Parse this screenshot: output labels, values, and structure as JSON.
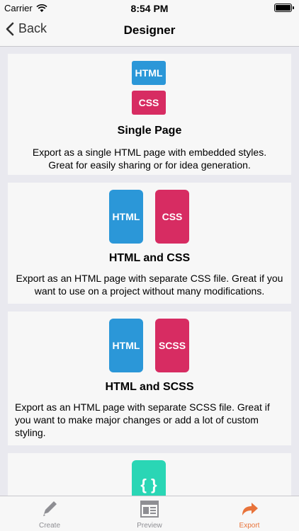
{
  "status_bar": {
    "carrier": "Carrier",
    "time": "8:54 PM"
  },
  "nav": {
    "back_label": "Back",
    "title": "Designer"
  },
  "options": [
    {
      "title": "Single Page",
      "tile1": "HTML",
      "tile2": "CSS",
      "description": "Export as a single HTML page with embedded styles. Great for easily sharing or for idea generation."
    },
    {
      "title": "HTML and CSS",
      "tile1": "HTML",
      "tile2": "CSS",
      "description": "Export as an HTML page with separate CSS file. Great if you want to use on a project without many modifications."
    },
    {
      "title": "HTML and SCSS",
      "tile1": "HTML",
      "tile2": "SCSS",
      "description": "Export as an HTML page with separate SCSS file. Great if you want to make major changes or add a lot of custom styling."
    },
    {
      "tile1": "{ }"
    }
  ],
  "tabs": [
    {
      "label": "Create",
      "icon": "pencil-icon"
    },
    {
      "label": "Preview",
      "icon": "preview-icon"
    },
    {
      "label": "Export",
      "icon": "export-arrow-icon"
    }
  ],
  "colors": {
    "accent": "#e8733a",
    "html_blue": "#2b97d8",
    "css_pink": "#d72c62",
    "json_teal": "#2ad6b5"
  }
}
